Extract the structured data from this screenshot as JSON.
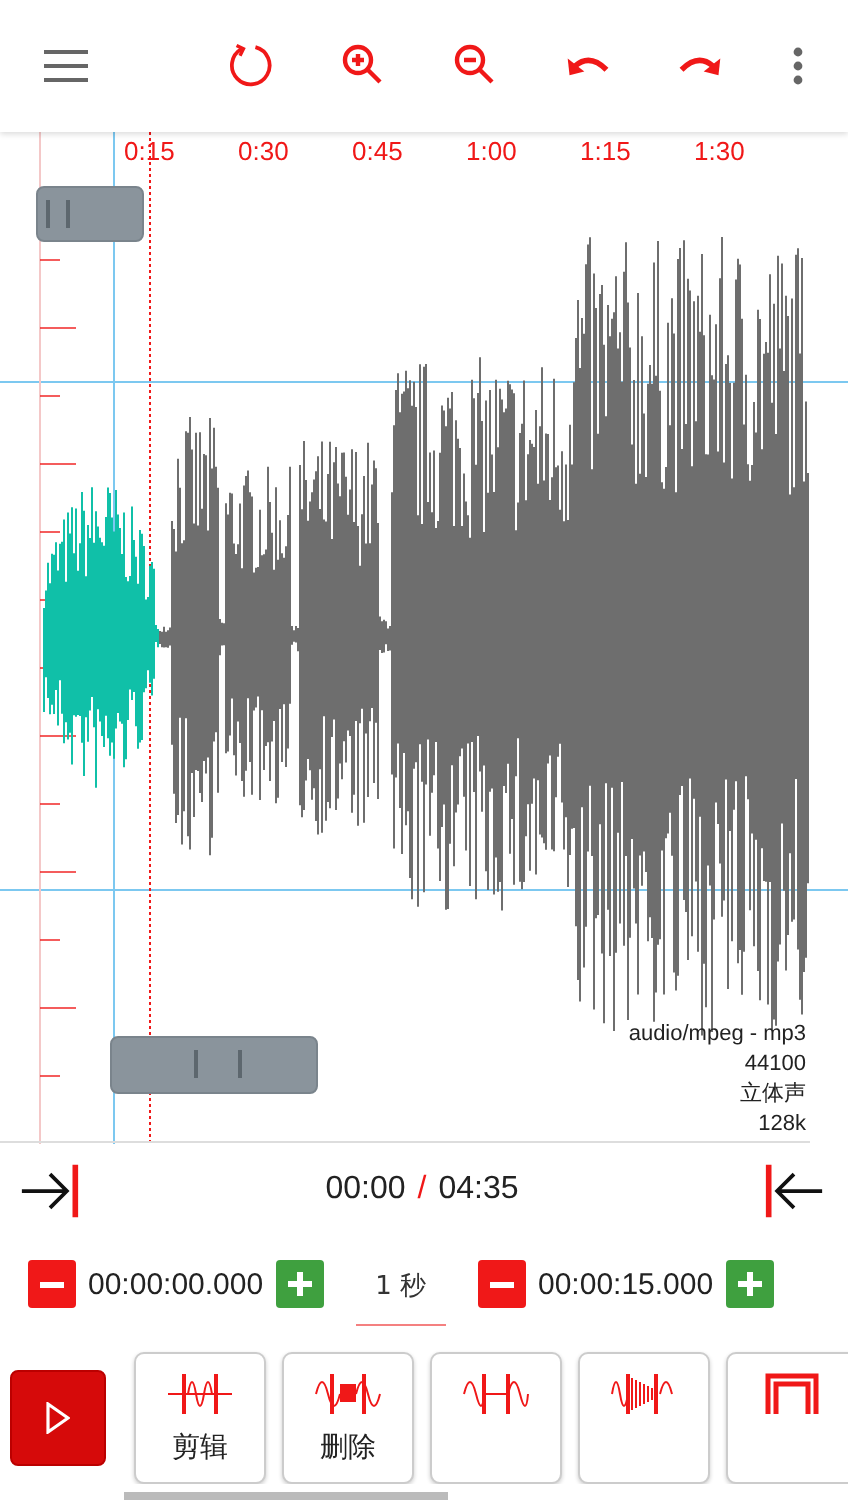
{
  "timeline": {
    "labels": [
      "0:15",
      "0:30",
      "0:45",
      "1:00",
      "1:15",
      "1:30"
    ]
  },
  "file_info": [
    "audio/mpeg - mp3",
    "44100",
    "立体声",
    "128k"
  ],
  "position": {
    "current": "00:00",
    "separator": "/",
    "total": "04:35"
  },
  "selection": {
    "start": "00:00:00.000",
    "step": "1 秒",
    "end": "00:00:15.000"
  },
  "tools": [
    {
      "kind": "trim",
      "label": "剪辑"
    },
    {
      "kind": "delete",
      "label": "删除"
    },
    {
      "kind": "silence"
    },
    {
      "kind": "fade"
    },
    {
      "kind": "crop"
    }
  ]
}
